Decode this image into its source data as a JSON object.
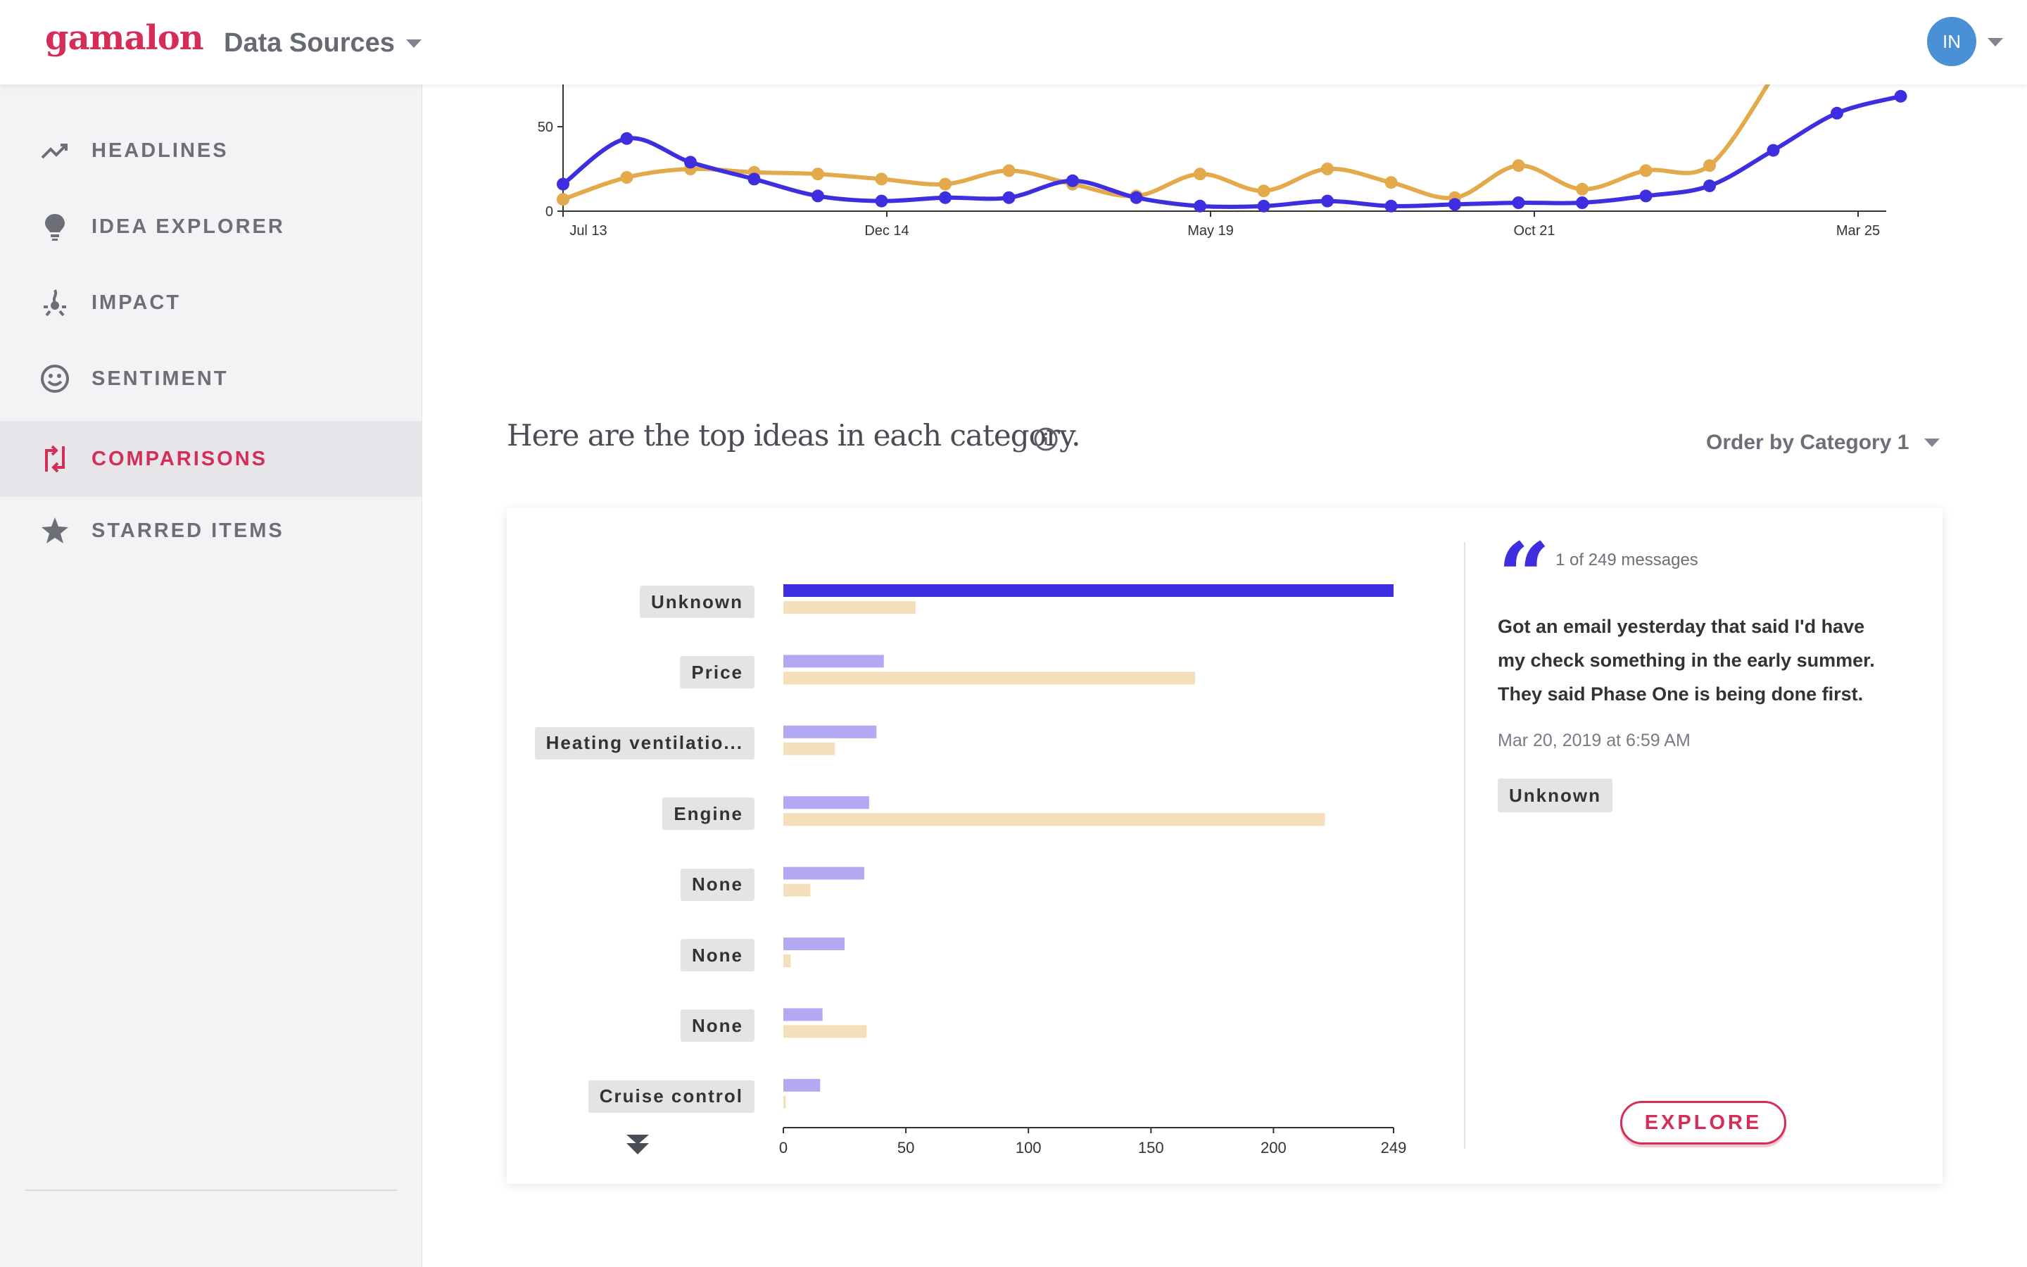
{
  "app": {
    "logo": "gamalon",
    "data_sources_label": "Data Sources",
    "user_initials": "IN"
  },
  "sidebar": {
    "items": [
      {
        "label": "HEADLINES",
        "icon": "trending-up-icon",
        "active": false
      },
      {
        "label": "IDEA EXPLORER",
        "icon": "lightbulb-icon",
        "active": false
      },
      {
        "label": "IMPACT",
        "icon": "impact-icon",
        "active": false
      },
      {
        "label": "SENTIMENT",
        "icon": "smiley-icon",
        "active": false
      },
      {
        "label": "COMPARISONS",
        "icon": "compare-icon",
        "active": true
      },
      {
        "label": "STARRED ITEMS",
        "icon": "star-icon",
        "active": false
      }
    ]
  },
  "main": {
    "section_title": "Here are the top ideas in each category.",
    "order_by_label": "Order by Category 1"
  },
  "colors": {
    "series1": "#3d2ee0",
    "series2": "#e3a94a",
    "series1_light": "#b3a9f2",
    "series2_light": "#f5dfba",
    "accent": "#d42e58"
  },
  "chart_data": [
    {
      "type": "line",
      "x_tick_labels": [
        "Jul 13",
        "Dec 14",
        "May 19",
        "Oct 21",
        "Mar 25"
      ],
      "y_tick_labels": [
        "0",
        "50"
      ],
      "ylim": [
        0,
        75
      ],
      "series": [
        {
          "values": [
            16,
            43,
            29,
            19,
            9,
            6,
            8,
            8,
            18,
            8,
            3,
            3,
            6,
            3,
            4,
            5,
            5,
            9,
            15,
            36,
            58,
            68
          ]
        },
        {
          "values": [
            7,
            20,
            25,
            23,
            22,
            19,
            16,
            24,
            16,
            9,
            22,
            12,
            25,
            17,
            8,
            27,
            13,
            24,
            27,
            80
          ]
        }
      ]
    },
    {
      "type": "bar",
      "orientation": "horizontal",
      "categories": [
        "Unknown",
        "Price",
        "Heating ventilatio...",
        "Engine",
        "None",
        "None",
        "None",
        "Cruise control"
      ],
      "series": [
        {
          "values": [
            249,
            41,
            38,
            35,
            33,
            25,
            16,
            15
          ]
        },
        {
          "values": [
            54,
            168,
            21,
            221,
            11,
            3,
            34,
            1
          ]
        }
      ],
      "x_tick_labels": [
        "0",
        "50",
        "100",
        "150",
        "200",
        "249"
      ],
      "xlim": [
        0,
        249
      ]
    }
  ],
  "message": {
    "count_label": "1 of 249 messages",
    "text": "Got an email yesterday that said I'd have my check something in the early summer. They said Phase One is being done first.",
    "date": "Mar 20, 2019 at 6:59 AM",
    "tag": "Unknown",
    "explore_label": "EXPLORE"
  }
}
